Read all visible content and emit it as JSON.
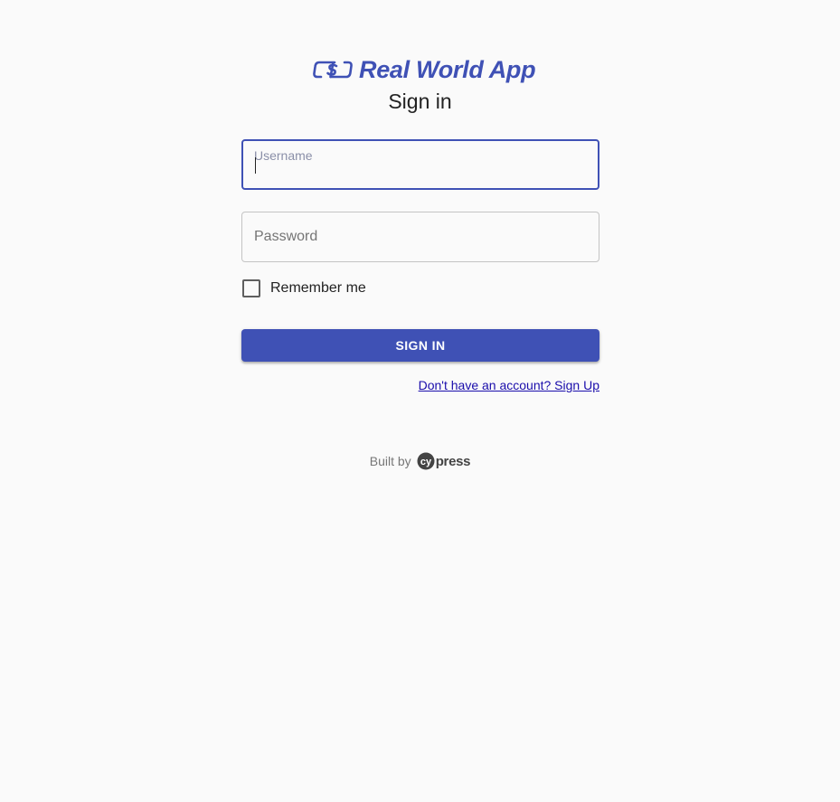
{
  "app": {
    "name": "Real World App",
    "logo_icon": "dollar-exchange-icon",
    "accent_color": "#3f51b5"
  },
  "form": {
    "title": "Sign in",
    "username": {
      "label": "Username",
      "value": ""
    },
    "password": {
      "placeholder": "Password",
      "value": ""
    },
    "remember_me": {
      "label": "Remember me",
      "checked": false
    },
    "submit_label": "SIGN IN",
    "signup_link": "Don't have an account? Sign Up"
  },
  "footer": {
    "built_by": "Built by",
    "brand": "press",
    "brand_logo_text": "cy"
  }
}
